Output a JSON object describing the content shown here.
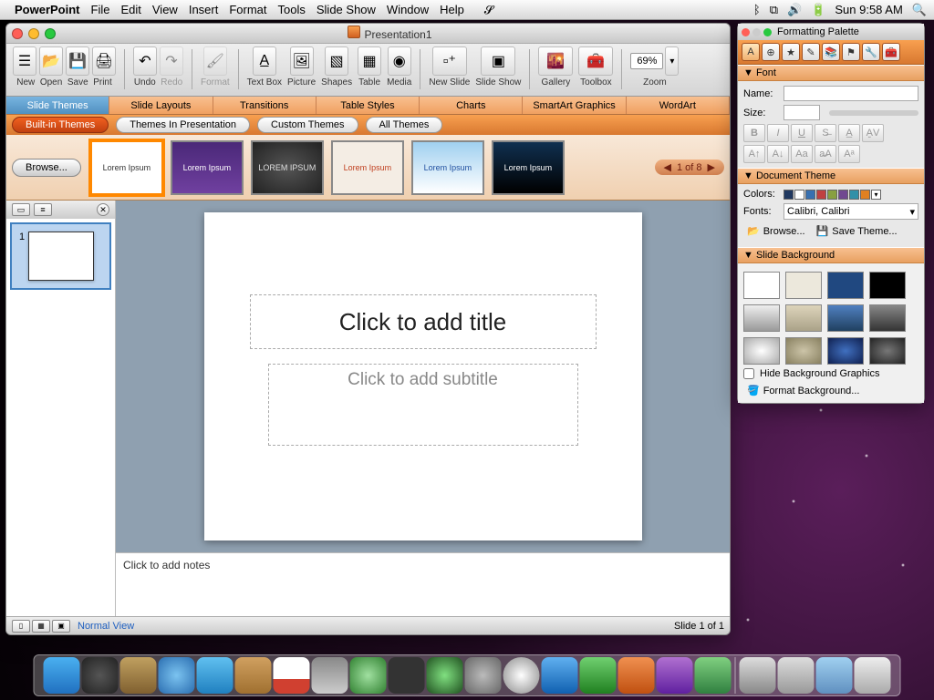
{
  "menubar": {
    "app": "PowerPoint",
    "items": [
      "File",
      "Edit",
      "View",
      "Insert",
      "Format",
      "Tools",
      "Slide Show",
      "Window",
      "Help"
    ],
    "clock": "Sun 9:58 AM"
  },
  "window": {
    "title": "Presentation1",
    "toolbar": {
      "new": "New",
      "open": "Open",
      "save": "Save",
      "print": "Print",
      "undo": "Undo",
      "redo": "Redo",
      "format": "Format",
      "textbox": "Text Box",
      "picture": "Picture",
      "shapes": "Shapes",
      "table": "Table",
      "media": "Media",
      "newslide": "New Slide",
      "slideshow": "Slide Show",
      "gallery": "Gallery",
      "toolbox": "Toolbox",
      "zoom_label": "Zoom",
      "zoom_val": "69%"
    },
    "ribbon_tabs": [
      "Slide Themes",
      "Slide Layouts",
      "Transitions",
      "Table Styles",
      "Charts",
      "SmartArt Graphics",
      "WordArt"
    ],
    "ribbon_sub": {
      "builtin": "Built-in Themes",
      "inpres": "Themes In Presentation",
      "custom": "Custom Themes",
      "all": "All Themes"
    },
    "browse": "Browse...",
    "themes": [
      "Lorem Ipsum",
      "Lorem Ipsum",
      "LOREM IPSUM",
      "Lorem Ipsum",
      "Lorem Ipsum",
      "Lorem Ipsum"
    ],
    "pager": "1 of 8",
    "slide": {
      "title_ph": "Click to add title",
      "sub_ph": "Click to add subtitle"
    },
    "notes_ph": "Click to add notes",
    "status": {
      "view": "Normal View",
      "slide": "Slide 1 of 1"
    },
    "thumb_num": "1"
  },
  "palette": {
    "title": "Formatting Palette",
    "font": {
      "hdr": "Font",
      "name_label": "Name:",
      "size_label": "Size:"
    },
    "theme": {
      "hdr": "Document Theme",
      "colors": "Colors:",
      "fonts": "Fonts:",
      "font_val": "Calibri, Calibri",
      "browse": "Browse...",
      "save": "Save Theme...",
      "swatches": [
        "#203860",
        "#ffffff",
        "#3870b0",
        "#c04040",
        "#88a040",
        "#704890",
        "#3090a8",
        "#e08020"
      ]
    },
    "bg": {
      "hdr": "Slide Background",
      "hide": "Hide Background Graphics",
      "format": "Format Background...",
      "samples": [
        "#ffffff",
        "#ece8dc",
        "#204880",
        "#000000",
        "#d0d0d0",
        "#bcb49c",
        "#406090",
        "#606060",
        "#b0b0b0",
        "#a09878",
        "#203060",
        "#404040"
      ]
    }
  }
}
